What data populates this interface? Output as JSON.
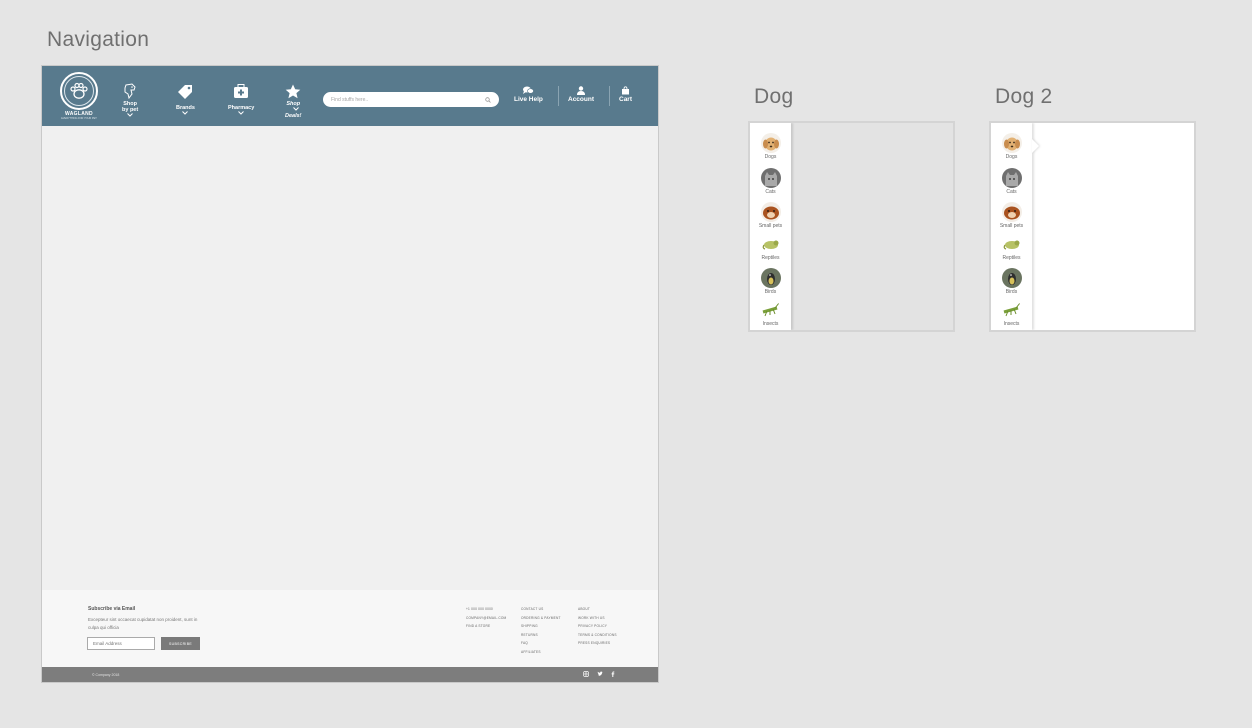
{
  "artboards": {
    "navigation_title": "Navigation",
    "dog_title": "Dog",
    "dog2_title": "Dog 2"
  },
  "header": {
    "brand_name": "WAGLAND",
    "brand_tagline": "EVERYTHING FOR YOUR PET",
    "nav": {
      "shop_by_pet_line1": "Shop",
      "shop_by_pet_line2": "by pet",
      "brands": "Brands",
      "pharmacy": "Pharmacy",
      "shop_deals_line1": "Shop",
      "shop_deals_line2": "Deals!"
    },
    "search_placeholder": "Find stuffs here..",
    "live_help": "Live Help",
    "account": "Account",
    "cart": "Cart",
    "color": "#587a8d"
  },
  "footer": {
    "subscribe_title": "Subscribe via Email",
    "subscribe_desc": "Excepteur sint occaecat cupidatat non proident, sunt in culpa qui officia",
    "email_placeholder": "Email Address",
    "subscribe_button": "SUBSCRIBE",
    "col1": [
      "+1 000 000 0000",
      "COMPANY@EMAIL.COM",
      "FIND A STORE"
    ],
    "col2": [
      "CONTACT US",
      "ORDERING & PAYMENT",
      "SHIPPING",
      "RETURNS",
      "FAQ",
      "AFFILIATES"
    ],
    "col3": [
      "ABOUT",
      "WORK WITH US",
      "PRIVACY POLICY",
      "TERMS & CONDITIONS",
      "PRESS ENQUIRIES"
    ],
    "copyright": "© Company 2018",
    "social_icons": [
      "instagram-icon",
      "twitter-icon",
      "facebook-icon"
    ]
  },
  "pets": [
    {
      "label": "Dogs",
      "color": "#e8b87a"
    },
    {
      "label": "Cats",
      "color": "#8e8e8e"
    },
    {
      "label": "Small pets",
      "color": "#b05a2c"
    },
    {
      "label": "Reptiles",
      "color": "#a8b85a"
    },
    {
      "label": "Birds",
      "color": "#5a6a4a"
    },
    {
      "label": "Insects",
      "color": "#7a9a3a"
    }
  ]
}
